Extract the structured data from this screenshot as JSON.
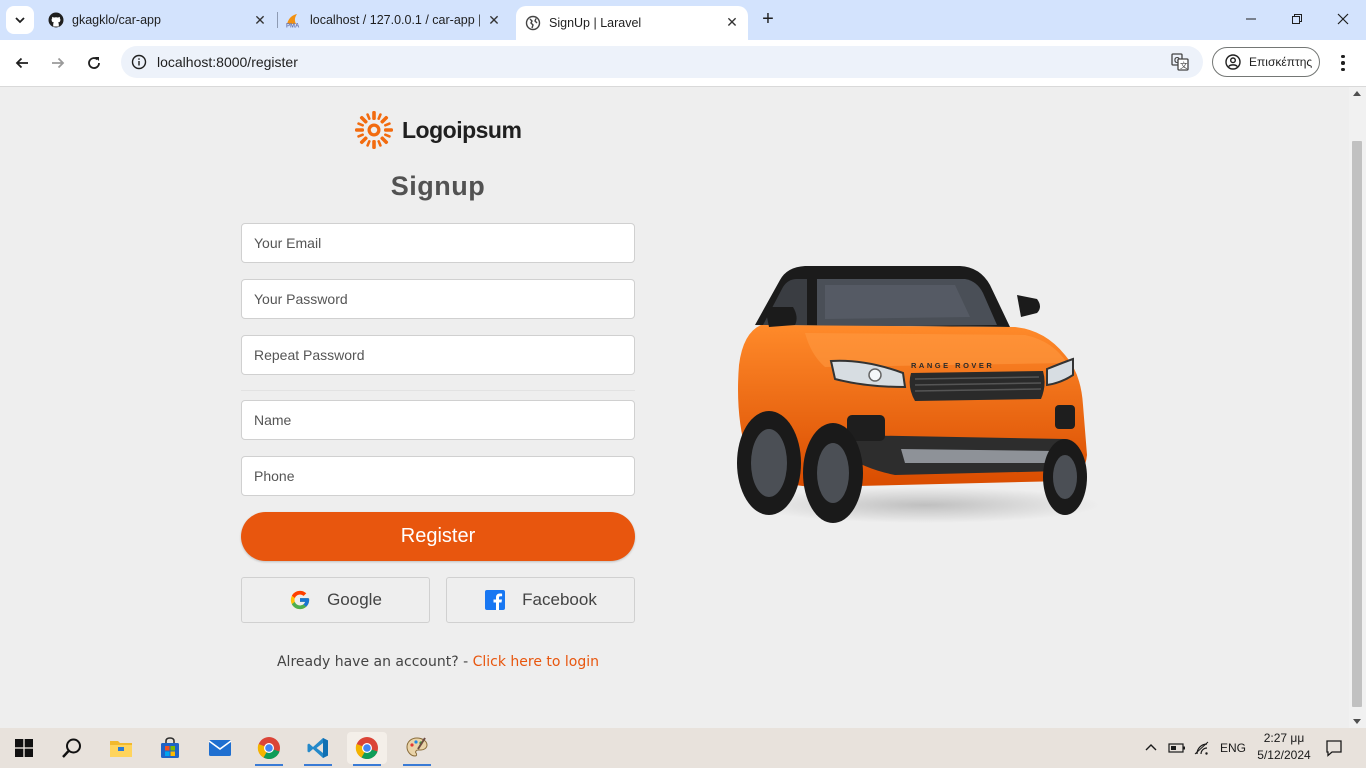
{
  "browser": {
    "tabs": [
      {
        "title": "gkagklo/car-app",
        "icon": "github-icon"
      },
      {
        "title": "localhost / 127.0.0.1 / car-app |",
        "icon": "phpmyadmin-icon"
      },
      {
        "title": "SignUp | Laravel",
        "icon": "globe-icon",
        "active": true
      }
    ],
    "url_host": "localhost",
    "url_path": ":8000/register",
    "profile_label": "Επισκέπτης"
  },
  "page": {
    "logo_text": "Logoipsum",
    "title": "Signup",
    "fields": {
      "email_placeholder": "Your Email",
      "password_placeholder": "Your Password",
      "repeat_password_placeholder": "Repeat Password",
      "name_placeholder": "Name",
      "phone_placeholder": "Phone"
    },
    "register_label": "Register",
    "google_label": "Google",
    "facebook_label": "Facebook",
    "login_prompt": "Already have an account? - ",
    "login_link": "Click here to login",
    "accent_color": "#e8560e"
  },
  "taskbar": {
    "apps": [
      "windows-start",
      "search",
      "file-explorer",
      "microsoft-store",
      "mail",
      "chrome",
      "vscode",
      "chrome",
      "paint"
    ],
    "language": "ENG",
    "time": "2:27 μμ",
    "date": "5/12/2024"
  }
}
